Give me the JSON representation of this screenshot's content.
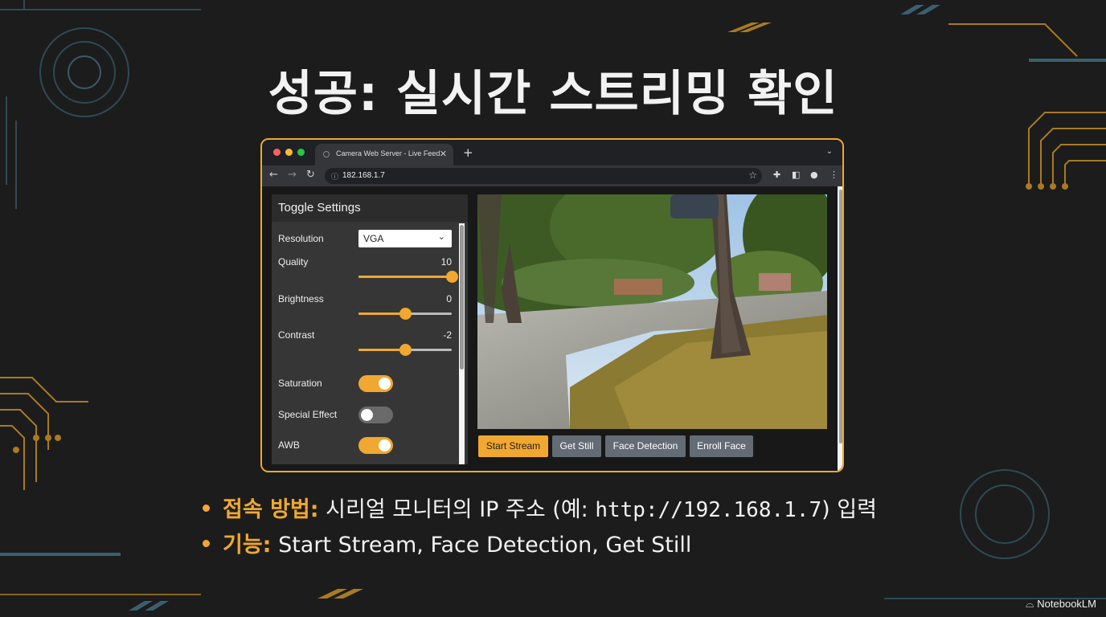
{
  "slide": {
    "title": "성공: 실시간 스트리밍 확인",
    "watermark": "NotebookLM"
  },
  "browser": {
    "tab_title": "Camera Web Server - Live Feed",
    "address": "182.168.1.7"
  },
  "settings": {
    "title": "Toggle Settings",
    "resolution": {
      "label": "Resolution",
      "value": "VGA"
    },
    "quality": {
      "label": "Quality",
      "value": "10",
      "level": 1.0
    },
    "brightness": {
      "label": "Brightness",
      "value": "0",
      "level": 0.5
    },
    "contrast": {
      "label": "Contrast",
      "value": "-2",
      "level": 0.5
    },
    "saturation": {
      "label": "Saturation",
      "on": true
    },
    "special_effect": {
      "label": "Special Effect",
      "on": false
    },
    "awb": {
      "label": "AWB",
      "on": true
    }
  },
  "buttons": {
    "start_stream": "Start Stream",
    "get_still": "Get Still",
    "face_detection": "Face Detection",
    "enroll_face": "Enroll Face"
  },
  "bullets": [
    {
      "key": "접속 방법:",
      "pre": " 시리얼 모니터의 IP 주소 (예: ",
      "code": "http://192.168.1.7",
      "post": ") 입력"
    },
    {
      "key": "기능:",
      "text": " Start Stream, Face Detection, Get Still"
    }
  ],
  "colors": {
    "accent": "#f0a830",
    "secondary_button": "#636b74",
    "background": "#1c1c1c"
  }
}
